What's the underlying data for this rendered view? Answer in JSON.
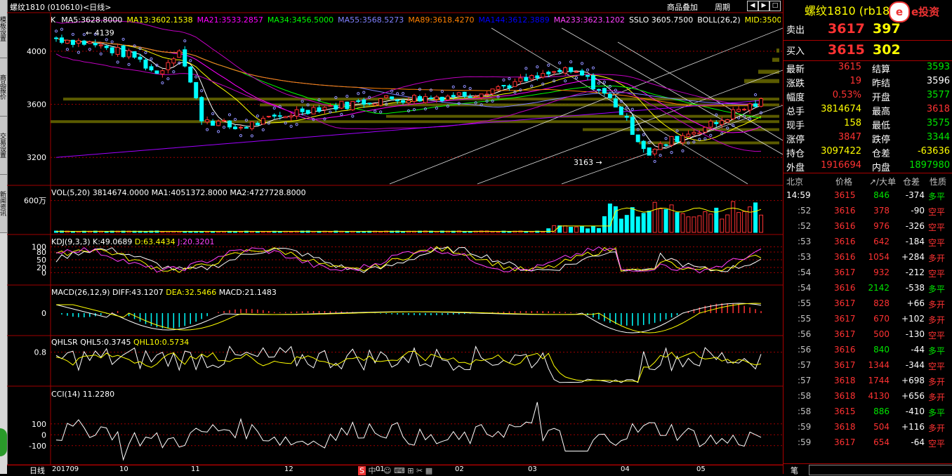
{
  "header": {
    "title": "螺纹1810 (010610)<日线>",
    "ma_k": "K",
    "ma": [
      {
        "label": "MA5:3628.8000",
        "color": "#ffffff"
      },
      {
        "label": "MA13:3602.1538",
        "color": "#ffff00"
      },
      {
        "label": "MA21:3533.2857",
        "color": "#ff00ff"
      },
      {
        "label": "MA34:3456.5000",
        "color": "#00ff00"
      },
      {
        "label": "MA55:3568.5273",
        "color": "#8080ff"
      },
      {
        "label": "MA89:3618.4270",
        "color": "#ff8000"
      },
      {
        "label": "MA144:3612.3889",
        "color": "#0000ff"
      },
      {
        "label": "MA233:3623.1202",
        "color": "#ff40ff"
      },
      {
        "label": "SSLO 3605.7500",
        "color": "#ffffff"
      },
      {
        "label": "BOLL(26,2)",
        "color": "#ffffff"
      },
      {
        "label": "MID:3500",
        "color": "#ffff00"
      }
    ],
    "menu": [
      "商品叠加",
      "周期"
    ],
    "nav_icons": [
      "left-arrow-icon",
      "right-arrow-icon",
      "expand-icon"
    ]
  },
  "left_tabs": [
    "模板设置",
    "商品报价",
    "交易设置",
    "新闻资讯"
  ],
  "bottom_bar": {
    "period": "日线",
    "months": [
      "201709",
      "10",
      "11",
      "12",
      "01",
      "02",
      "03",
      "04",
      "05"
    ]
  },
  "chart_data": [
    {
      "type": "candlestick",
      "panel": "price",
      "y_ticks": [
        4000,
        3600,
        3200
      ],
      "ylim": [
        3000,
        4280
      ],
      "annotations": [
        {
          "text": "4139",
          "value": 4139
        },
        {
          "text": "3163",
          "value": 3163
        }
      ],
      "series_count": 127
    },
    {
      "type": "bar",
      "panel": "volume",
      "label": "VOL(5,20) 3814674.0000  MA1:4051372.8000  MA2:4727728.8000",
      "y_ticks_text": [
        "600万"
      ],
      "ylim": [
        0,
        7000000
      ]
    },
    {
      "type": "line",
      "panel": "kdj",
      "label": "KDJ(9,3,3)",
      "values_text": [
        "K:49.0689",
        "D:63.4434",
        "J:20.3201"
      ],
      "y_ticks": [
        100,
        80,
        50,
        20,
        0
      ],
      "ylim": [
        -10,
        110
      ]
    },
    {
      "type": "bar",
      "panel": "macd",
      "label": "MACD(26,12,9)",
      "values_text": [
        "DIFF:43.1207",
        "DEA:32.5466",
        "MACD:21.1483"
      ],
      "y_ticks": [
        0
      ]
    },
    {
      "type": "line",
      "panel": "qhlsr",
      "label": "QHLSR",
      "values_text": [
        "QHL5:0.3745",
        "QHL10:0.5734"
      ],
      "y_ticks": [
        0.8
      ],
      "ylim": [
        0,
        1
      ]
    },
    {
      "type": "line",
      "panel": "cci",
      "label": "CCI(14)",
      "values_text": [
        "11.2280"
      ],
      "y_ticks": [
        100,
        0,
        -100
      ],
      "ylim": [
        -250,
        350
      ]
    }
  ],
  "quote": {
    "title": "螺纹1810 (rb1810)",
    "logo": "e投资",
    "sell": {
      "label": "卖出",
      "price": "3617",
      "vol": "397"
    },
    "buy": {
      "label": "买入",
      "price": "3615",
      "vol": "302"
    },
    "rows": [
      {
        "l1": "最新",
        "v1": "3615",
        "c1": "red",
        "l2": "结算",
        "v2": "3593",
        "c2": "green"
      },
      {
        "l1": "涨跌",
        "v1": "19",
        "c1": "red",
        "l2": "昨结",
        "v2": "3596",
        "c2": "white"
      },
      {
        "l1": "幅度",
        "v1": "0.53%",
        "c1": "red",
        "l2": "开盘",
        "v2": "3577",
        "c2": "green"
      },
      {
        "l1": "总手",
        "v1": "3814674",
        "c1": "yellow",
        "l2": "最高",
        "v2": "3618",
        "c2": "red"
      },
      {
        "l1": "现手",
        "v1": "158",
        "c1": "yellow",
        "l2": "最低",
        "v2": "3575",
        "c2": "green"
      },
      {
        "l1": "涨停",
        "v1": "3847",
        "c1": "red",
        "l2": "跌停",
        "v2": "3344",
        "c2": "green"
      },
      {
        "l1": "持仓",
        "v1": "3097422",
        "c1": "yellow",
        "l2": "仓差",
        "v2": "-63636",
        "c2": "yellow"
      },
      {
        "l1": "外盘",
        "v1": "1916694",
        "c1": "red",
        "l2": "内盘",
        "v2": "1897980",
        "c2": "green"
      }
    ],
    "tick_header": [
      "北京",
      "价格",
      "↗/大单",
      "仓差",
      "性质"
    ],
    "ticks": [
      {
        "t": "14:59",
        "p": "3615",
        "v": "846",
        "vc": "green",
        "d": "-374",
        "n": "多平",
        "nc": "green"
      },
      {
        "t": ":52",
        "p": "3616",
        "v": "378",
        "vc": "red",
        "d": "-90",
        "n": "空平",
        "nc": "red"
      },
      {
        "t": ":52",
        "p": "3616",
        "v": "976",
        "vc": "red",
        "d": "-326",
        "n": "空平",
        "nc": "red"
      },
      {
        "t": ":53",
        "p": "3616",
        "v": "642",
        "vc": "red",
        "d": "-184",
        "n": "空平",
        "nc": "red"
      },
      {
        "t": ":53",
        "p": "3616",
        "v": "1054",
        "vc": "red",
        "d": "+284",
        "n": "多开",
        "nc": "red"
      },
      {
        "t": ":54",
        "p": "3617",
        "v": "932",
        "vc": "red",
        "d": "-212",
        "n": "空平",
        "nc": "red"
      },
      {
        "t": ":54",
        "p": "3616",
        "v": "2142",
        "vc": "green",
        "d": "-538",
        "n": "多平",
        "nc": "green"
      },
      {
        "t": ":55",
        "p": "3617",
        "v": "828",
        "vc": "red",
        "d": "+66",
        "n": "多开",
        "nc": "red"
      },
      {
        "t": ":55",
        "p": "3617",
        "v": "670",
        "vc": "red",
        "d": "+102",
        "n": "多开",
        "nc": "red"
      },
      {
        "t": ":56",
        "p": "3617",
        "v": "500",
        "vc": "red",
        "d": "-130",
        "n": "空平",
        "nc": "red"
      },
      {
        "t": ":56",
        "p": "3616",
        "v": "840",
        "vc": "green",
        "d": "-44",
        "n": "多平",
        "nc": "green"
      },
      {
        "t": ":57",
        "p": "3617",
        "v": "1344",
        "vc": "red",
        "d": "-344",
        "n": "空平",
        "nc": "red"
      },
      {
        "t": ":57",
        "p": "3618",
        "v": "1744",
        "vc": "red",
        "d": "+698",
        "n": "多开",
        "nc": "red"
      },
      {
        "t": ":58",
        "p": "3618",
        "v": "4130",
        "vc": "red",
        "d": "+656",
        "n": "多开",
        "nc": "red"
      },
      {
        "t": ":58",
        "p": "3615",
        "v": "886",
        "vc": "green",
        "d": "-410",
        "n": "多平",
        "nc": "green"
      },
      {
        "t": ":59",
        "p": "3618",
        "v": "504",
        "vc": "red",
        "d": "+116",
        "n": "多开",
        "nc": "red"
      },
      {
        "t": ":59",
        "p": "3617",
        "v": "654",
        "vc": "red",
        "d": "-64",
        "n": "空平",
        "nc": "red"
      }
    ],
    "bottom_label": "笔"
  },
  "colors": {
    "up": "#ff3232",
    "down": "#00ffff",
    "grid": "#a00000",
    "accent": "#ffff00"
  }
}
